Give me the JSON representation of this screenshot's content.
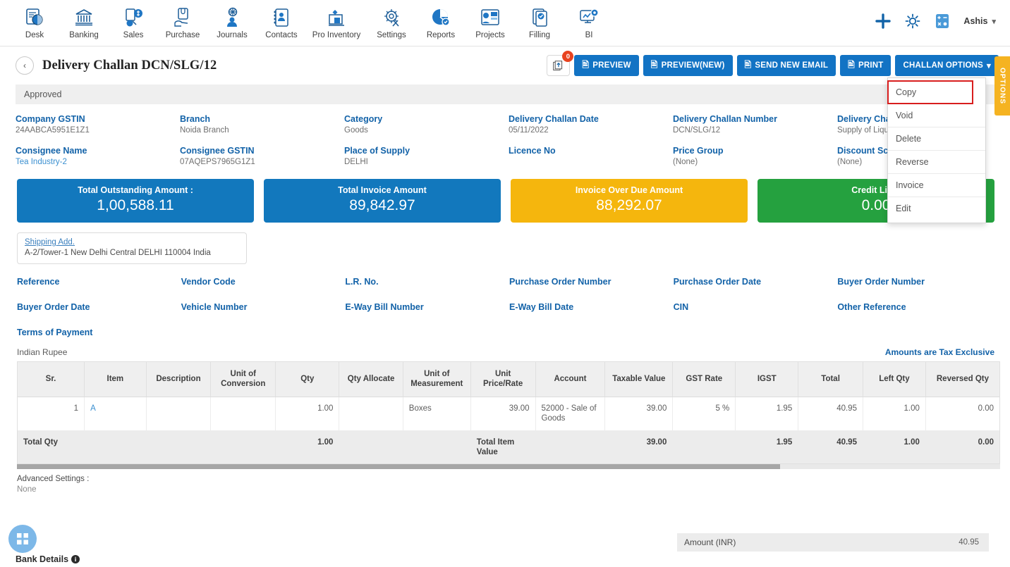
{
  "nav": {
    "items": [
      {
        "label": "Desk",
        "icon": "desk-icon"
      },
      {
        "label": "Banking",
        "icon": "bank-icon"
      },
      {
        "label": "Sales",
        "icon": "sales-icon"
      },
      {
        "label": "Purchase",
        "icon": "purchase-icon"
      },
      {
        "label": "Journals",
        "icon": "journals-icon"
      },
      {
        "label": "Contacts",
        "icon": "contacts-icon"
      },
      {
        "label": "Pro Inventory",
        "icon": "inventory-icon"
      },
      {
        "label": "Settings",
        "icon": "settings-icon"
      },
      {
        "label": "Reports",
        "icon": "reports-icon"
      },
      {
        "label": "Projects",
        "icon": "projects-icon"
      },
      {
        "label": "Filling",
        "icon": "filling-icon"
      },
      {
        "label": "BI",
        "icon": "bi-icon"
      }
    ],
    "right": {
      "add_icon": "plus-icon",
      "settings_icon": "gear-icon",
      "calculator_icon": "calculator-icon",
      "user_name": "Ashis",
      "caret": "chevron-down-icon"
    }
  },
  "header": {
    "back_icon": "chevron-left-icon",
    "title": "Delivery Challan DCN/SLG/12",
    "upload_badge": "0",
    "upload_icon": "upload-documents-icon",
    "buttons": [
      {
        "label": "PREVIEW",
        "icon": "document-icon"
      },
      {
        "label": "PREVIEW(NEW)",
        "icon": "document-icon"
      },
      {
        "label": "SEND NEW EMAIL",
        "icon": "document-icon"
      },
      {
        "label": "PRINT",
        "icon": "document-icon"
      },
      {
        "label": "CHALLAN OPTIONS",
        "icon": "caret-down-icon"
      }
    ],
    "options_tab": "OPTIONS"
  },
  "dropdown": {
    "items": [
      {
        "label": "Copy",
        "highlighted": true
      },
      {
        "label": "Void",
        "highlighted": false
      },
      {
        "label": "Delete",
        "highlighted": false
      },
      {
        "label": "Reverse",
        "highlighted": false
      },
      {
        "label": "Invoice",
        "highlighted": false
      },
      {
        "label": "Edit",
        "highlighted": false
      }
    ],
    "highlight_color": "#d81e1e"
  },
  "status": {
    "label": "Approved"
  },
  "details": [
    {
      "label": "Company GSTIN",
      "value": "24AABCA5951E1Z1",
      "link": false
    },
    {
      "label": "Branch",
      "value": "Noida Branch",
      "link": false
    },
    {
      "label": "Category",
      "value": "Goods",
      "link": false
    },
    {
      "label": "Delivery Challan Date",
      "value": "05/11/2022",
      "link": false
    },
    {
      "label": "Delivery Challan Number",
      "value": "DCN/SLG/12",
      "link": false
    },
    {
      "label": "Delivery Challan Type",
      "value": "Supply of Liquid",
      "link": false
    },
    {
      "label": "Consignee Name",
      "value": "Tea Industry-2",
      "link": true
    },
    {
      "label": "Consignee GSTIN",
      "value": "07AQEPS7965G1Z1",
      "link": false
    },
    {
      "label": "Place of Supply",
      "value": "DELHI",
      "link": false
    },
    {
      "label": "Licence No",
      "value": "",
      "link": false
    },
    {
      "label": "Price Group",
      "value": "(None)",
      "link": false
    },
    {
      "label": "Discount Scheme",
      "value": "(None)",
      "link": false
    }
  ],
  "cards": [
    {
      "label": "Total Outstanding Amount :",
      "value": "1,00,588.11",
      "color": "#1278bd"
    },
    {
      "label": "Total Invoice Amount",
      "value": "89,842.97",
      "color": "#1278bd"
    },
    {
      "label": "Invoice Over Due Amount",
      "value": "88,292.07",
      "color": "#f5b60d"
    },
    {
      "label": "Credit Limit",
      "value": "0.00",
      "color": "#25a13f"
    }
  ],
  "shipping": {
    "title": "Shipping Add.",
    "value": "A-2/Tower-1 New Delhi Central DELHI 110004 India"
  },
  "references": [
    "Reference",
    "Vendor Code",
    "L.R. No.",
    "Purchase Order Number",
    "Purchase Order Date",
    "Buyer Order Number",
    "Buyer Order Date",
    "Vehicle Number",
    "E-Way Bill Number",
    "E-Way Bill Date",
    "CIN",
    "Other Reference",
    "Terms of Payment"
  ],
  "table": {
    "currency": "Indian Rupee",
    "tax_note": "Amounts are Tax Exclusive",
    "columns": [
      "Sr.",
      "Item",
      "Description",
      "Unit of Conversion",
      "Qty",
      "Qty Allocate",
      "Unit of Measurement",
      "Unit Price/Rate",
      "Account",
      "Taxable Value",
      "GST Rate",
      "IGST",
      "Total",
      "Left Qty",
      "Reversed Qty"
    ],
    "rows": [
      {
        "sr": "1",
        "item": "A",
        "description": "",
        "unit_of_conversion": "",
        "qty": "1.00",
        "qty_allocate": "",
        "unit_of_measurement": "Boxes",
        "unit_price": "39.00",
        "account": "52000 - Sale of Goods",
        "taxable_value": "39.00",
        "gst_rate": "5 %",
        "igst": "1.95",
        "total": "40.95",
        "left_qty": "1.00",
        "reversed_qty": "0.00"
      }
    ],
    "totals": {
      "label": "Total Qty",
      "qty": "1.00",
      "item_value_label": "Total Item Value",
      "taxable_value": "39.00",
      "igst": "1.95",
      "total": "40.95",
      "left_qty": "1.00",
      "reversed_qty": "0.00"
    }
  },
  "advanced": {
    "label": "Advanced Settings :",
    "value": "None"
  },
  "amount": {
    "label": "Amount (INR)",
    "value": "40.95"
  },
  "footer": {
    "bank_details": "Bank Details",
    "info_icon": "info-icon",
    "fab_icon": "grid-apps-icon"
  }
}
